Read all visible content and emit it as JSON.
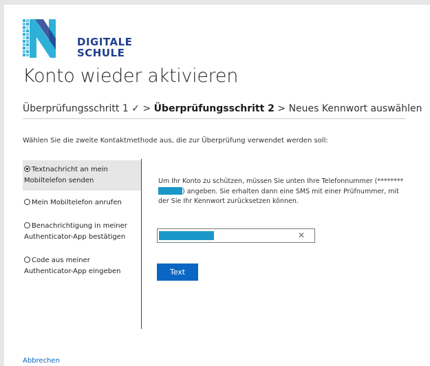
{
  "brand": {
    "line1": "DIGITALE",
    "line2": "SCHULE",
    "colors": {
      "logo_dark": "#1f3f8f",
      "logo_light": "#2fb0d8"
    }
  },
  "page_title": "Konto wieder aktivieren",
  "steps": {
    "step1": "Überprüfungsschritt 1",
    "check": "✓",
    "separator": ">",
    "step2": "Überprüfungsschritt 2",
    "step3": "Neues Kennwort auswählen"
  },
  "instruction": "Wählen Sie die zweite Kontaktmethode aus, die zur Überprüfung verwendet werden soll:",
  "methods": [
    {
      "label": "Textnachricht an mein Mobiltelefon senden",
      "selected": true
    },
    {
      "label": "Mein Mobiltelefon anrufen",
      "selected": false
    },
    {
      "label": "Benachrichtigung in meiner Authenticator-App bestätigen",
      "selected": false
    },
    {
      "label": "Code aus meiner Authenticator-App eingeben",
      "selected": false
    }
  ],
  "panel": {
    "text_before": "Um Ihr Konto zu schützen, müssen Sie unten Ihre Telefonnummer (********",
    "text_after": ") angeben. Sie erhalten dann eine SMS mit einer Prüfnummer, mit der Sie Ihr Kennwort zurücksetzen können."
  },
  "phone_input": {
    "clear_glyph": "✕"
  },
  "submit_button": "Text",
  "cancel_link": "Abbrechen",
  "colors": {
    "accent": "#0b66c3",
    "redaction": "#1b96c8",
    "link": "#0a63c0"
  }
}
